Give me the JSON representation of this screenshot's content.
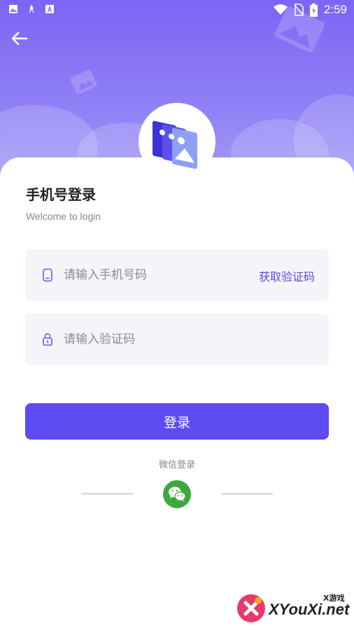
{
  "status_bar": {
    "time": "2:59"
  },
  "login": {
    "title": "手机号登录",
    "subtitle": "Welcome to login",
    "phone_placeholder": "请输入手机号码",
    "get_code_label": "获取验证码",
    "code_placeholder": "请输入验证码",
    "login_button": "登录",
    "wechat_label": "微信登录"
  },
  "watermark": {
    "brand": "XYouXi.net",
    "tag": "X游戏"
  },
  "colors": {
    "accent": "#5e4bf1",
    "header": "#7b66f5",
    "wechat": "#3ea83d",
    "field_bg": "#f4f5fa"
  },
  "icons": [
    "back-arrow-icon",
    "phone-icon",
    "lock-icon",
    "wechat-icon",
    "app-logo-icon",
    "wifi-icon",
    "battery-icon"
  ]
}
